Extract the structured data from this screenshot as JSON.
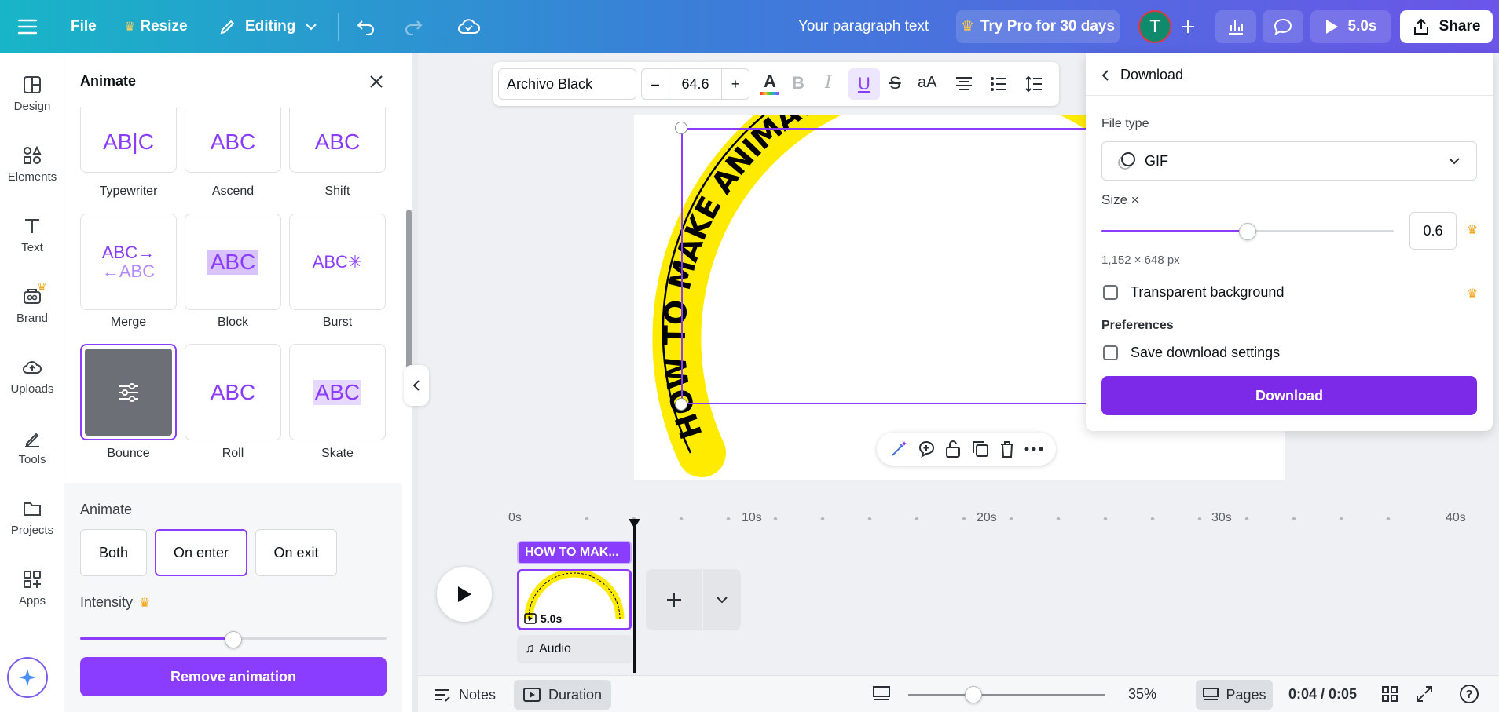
{
  "topbar": {
    "file": "File",
    "resize": "Resize",
    "editing": "Editing",
    "doc_title": "Your paragraph text",
    "try_pro": "Try Pro for 30 days",
    "avatar_initial": "T",
    "play_time": "5.0s",
    "share": "Share"
  },
  "rail": {
    "items": [
      {
        "label": "Design",
        "icon": "design-icon"
      },
      {
        "label": "Elements",
        "icon": "elements-icon"
      },
      {
        "label": "Text",
        "icon": "text-icon"
      },
      {
        "label": "Brand",
        "icon": "brand-icon"
      },
      {
        "label": "Uploads",
        "icon": "uploads-icon"
      },
      {
        "label": "Tools",
        "icon": "tools-icon"
      },
      {
        "label": "Projects",
        "icon": "projects-icon"
      },
      {
        "label": "Apps",
        "icon": "apps-icon"
      }
    ]
  },
  "animate_panel": {
    "title": "Animate",
    "tiles": [
      {
        "label": "Typewriter"
      },
      {
        "label": "Ascend"
      },
      {
        "label": "Shift"
      },
      {
        "label": "Merge"
      },
      {
        "label": "Block"
      },
      {
        "label": "Burst"
      },
      {
        "label": "Bounce",
        "selected": true
      },
      {
        "label": "Roll"
      },
      {
        "label": "Skate"
      }
    ],
    "animate_heading": "Animate",
    "modes": [
      "Both",
      "On enter",
      "On exit"
    ],
    "selected_mode": "On enter",
    "intensity_label": "Intensity",
    "intensity_level": 0.5,
    "remove": "Remove animation"
  },
  "text_toolbar": {
    "font": "Archivo Black",
    "size": "64.6",
    "minus": "–",
    "plus": "+"
  },
  "canvas": {
    "arc_text": "HOW TO MAKE ANIMATED SPLIN",
    "arc_color": "#ffeb00"
  },
  "download_panel": {
    "title": "Download",
    "file_type_label": "File type",
    "file_type": "GIF",
    "size_label": "Size ×",
    "size_value": "0.6",
    "size_level": 0.5,
    "dimensions": "1,152 × 648 px",
    "transparent_bg": "Transparent background",
    "preferences": "Preferences",
    "save_settings": "Save download settings",
    "download_button": "Download"
  },
  "timeline": {
    "ticks": [
      "0s",
      "10s",
      "20s",
      "30s",
      "40s"
    ],
    "text_track": "HOW TO MAK...",
    "page_duration": "5.0s",
    "audio": "Audio"
  },
  "bottom": {
    "notes": "Notes",
    "duration": "Duration",
    "zoom": "35%",
    "pages": "Pages",
    "time": "0:04 / 0:05",
    "zoom_level": 0.33
  },
  "colors": {
    "accent": "#8b3dff",
    "download_button": "#7d2ae8"
  }
}
